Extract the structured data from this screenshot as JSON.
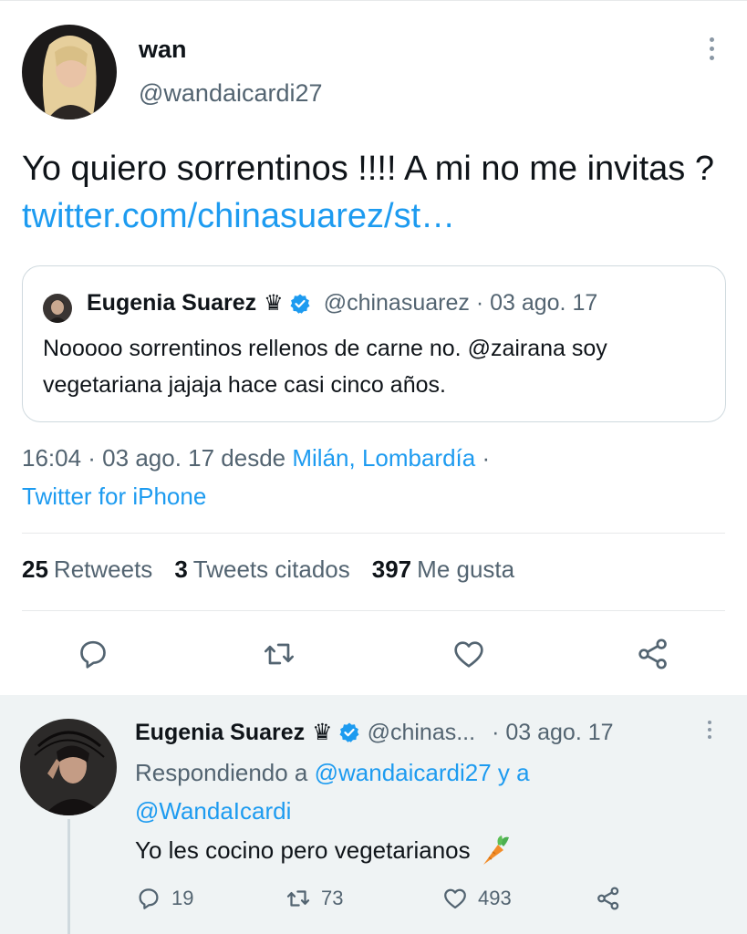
{
  "main_tweet": {
    "display_name": "wan",
    "handle": "@wandaicardi27",
    "text": "Yo quiero sorrentinos !!!! A mi no me invitas ? ",
    "link": "twitter.com/chinasuarez/st…",
    "quoted": {
      "display_name": "Eugenia Suarez",
      "crown": "♛",
      "meta": "@chinasuarez · 03 ago. 17",
      "text": "Nooooo sorrentinos rellenos de carne no. @zairana soy vegetariana jajaja hace casi cinco años."
    },
    "timestamp": "16:04 · 03 ago. 17 desde ",
    "location": "Milán, Lombardía",
    "separator": " ·",
    "source": "Twitter for iPhone",
    "stats": {
      "retweets_count": "25",
      "retweets_label": "Retweets",
      "quotes_count": "3",
      "quotes_label": "Tweets citados",
      "likes_count": "397",
      "likes_label": "Me gusta"
    }
  },
  "reply_tweet": {
    "display_name": "Eugenia Suarez",
    "crown": "♛",
    "handle": "@chinas...",
    "date": "· 03 ago. 17",
    "replying_prefix": "Respondiendo a ",
    "replying_to_1": "@wandaicardi27",
    "replying_conj": " y a",
    "replying_to_2": "@WandaIcardi",
    "text": "Yo les cocino pero vegetarianos",
    "reply_count": "19",
    "retweet_count": "73",
    "like_count": "493"
  },
  "icons": [
    "more-icon",
    "verified-icon",
    "reply-icon",
    "retweet-icon",
    "like-icon",
    "share-icon",
    "carrot-emoji"
  ],
  "colors": {
    "link": "#1d9bf0",
    "muted": "#536471",
    "text": "#0f1419",
    "verified": "#1d9bf0",
    "reply_bg": "#eff3f4"
  }
}
